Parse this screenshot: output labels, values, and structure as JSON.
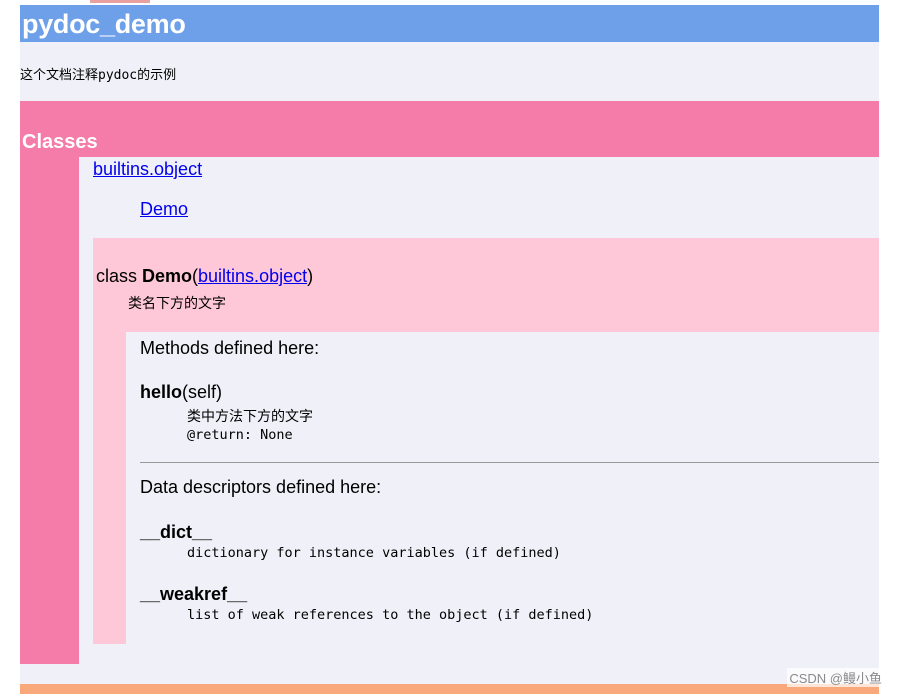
{
  "module": {
    "title": "pydoc_demo",
    "doc": "这个文档注释pydoc的示例"
  },
  "classes_section": {
    "title": "Classes",
    "tree": {
      "base_link": "builtins.object",
      "child_link": "Demo"
    }
  },
  "class_entry": {
    "keyword": "class ",
    "name": "Demo",
    "open_paren": "(",
    "base_link": "builtins.object",
    "close_paren": ")",
    "doc": "类名下方的文字"
  },
  "methods": {
    "label": "Methods defined here:",
    "items": [
      {
        "name": "hello",
        "args": "(self)",
        "doc_line1": "类中方法下方的文字",
        "doc_line2": "@return: None"
      }
    ]
  },
  "descriptors": {
    "label": "Data descriptors defined here:",
    "items": [
      {
        "name": "__dict__",
        "doc": "dictionary for instance variables (if defined)"
      },
      {
        "name": "__weakref__",
        "doc": "list of weak references to the object (if defined)"
      }
    ]
  },
  "watermark": "CSDN @鳗小鱼",
  "colors": {
    "title_bar": "#6da0e8",
    "classes_bar": "#f57ba8",
    "class_box": "#ffc8d8",
    "page_bg": "#f0f0f8",
    "footer_bar": "#f8a87a",
    "link": "#0000ee"
  }
}
